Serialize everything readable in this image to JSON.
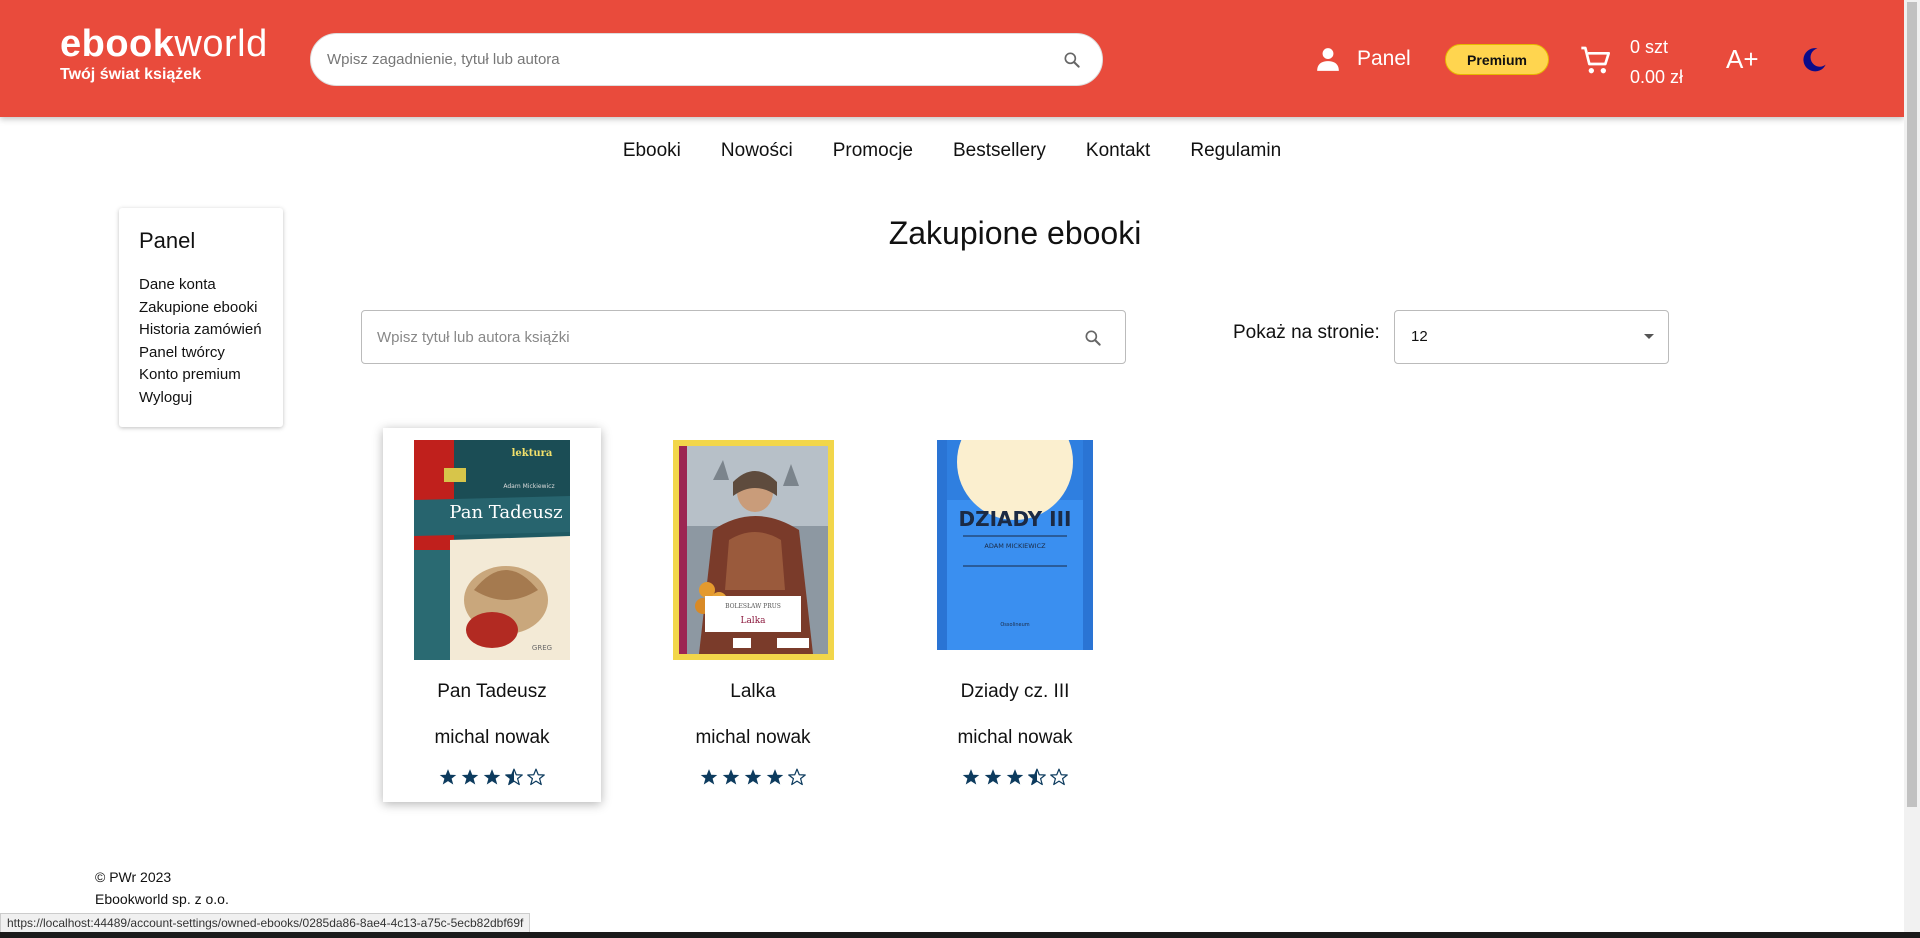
{
  "header": {
    "logo_bold": "ebook",
    "logo_light": "world",
    "logo_tagline": "Twój świat książek",
    "search_placeholder": "Wpisz zagadnienie, tytuł lub autora",
    "panel_label": "Panel",
    "premium_label": "Premium",
    "cart_count": "0 szt",
    "cart_total": "0.00 zł",
    "font_size_label": "A+",
    "colors": {
      "header_bg": "#e94b3c",
      "premium_bg": "#ffd54f",
      "moon": "#0b0b8a",
      "star": "#0d3b5e"
    }
  },
  "nav": {
    "items": [
      "Ebooki",
      "Nowości",
      "Promocje",
      "Bestsellery",
      "Kontakt",
      "Regulamin"
    ]
  },
  "sidebar": {
    "title": "Panel",
    "links": [
      "Dane konta",
      "Zakupione ebooki",
      "Historia zamówień",
      "Panel twórcy",
      "Konto premium",
      "Wyloguj"
    ]
  },
  "main": {
    "title": "Zakupione ebooki",
    "search_placeholder": "Wpisz tytuł lub autora książki",
    "per_page_label": "Pokaż na stronie:",
    "per_page_value": "12"
  },
  "books": [
    {
      "title": "Pan Tadeusz",
      "author": "michal nowak",
      "rating": 3.5,
      "cover_text": {
        "badge": "lektura",
        "author": "Adam Mickiewicz",
        "title": "Pan Tadeusz",
        "publisher": "GREG"
      }
    },
    {
      "title": "Lalka",
      "author": "michal nowak",
      "rating": 4,
      "cover_text": {
        "author": "BOLESŁAW PRUS",
        "title": "Lalka"
      }
    },
    {
      "title": "Dziady cz. III",
      "author": "michal nowak",
      "rating": 3.5,
      "cover_text": {
        "title": "DZIADY III",
        "author": "ADAM MICKIEWICZ",
        "publisher": "Ossolineum"
      }
    }
  ],
  "footer": {
    "copyright": "© PWr 2023",
    "company": "Ebookworld sp. z o.o."
  },
  "status_bar": {
    "url": "https://localhost:44489/account-settings/owned-ebooks/0285da86-8ae4-4c13-a75c-5ecb82dbf69f"
  }
}
